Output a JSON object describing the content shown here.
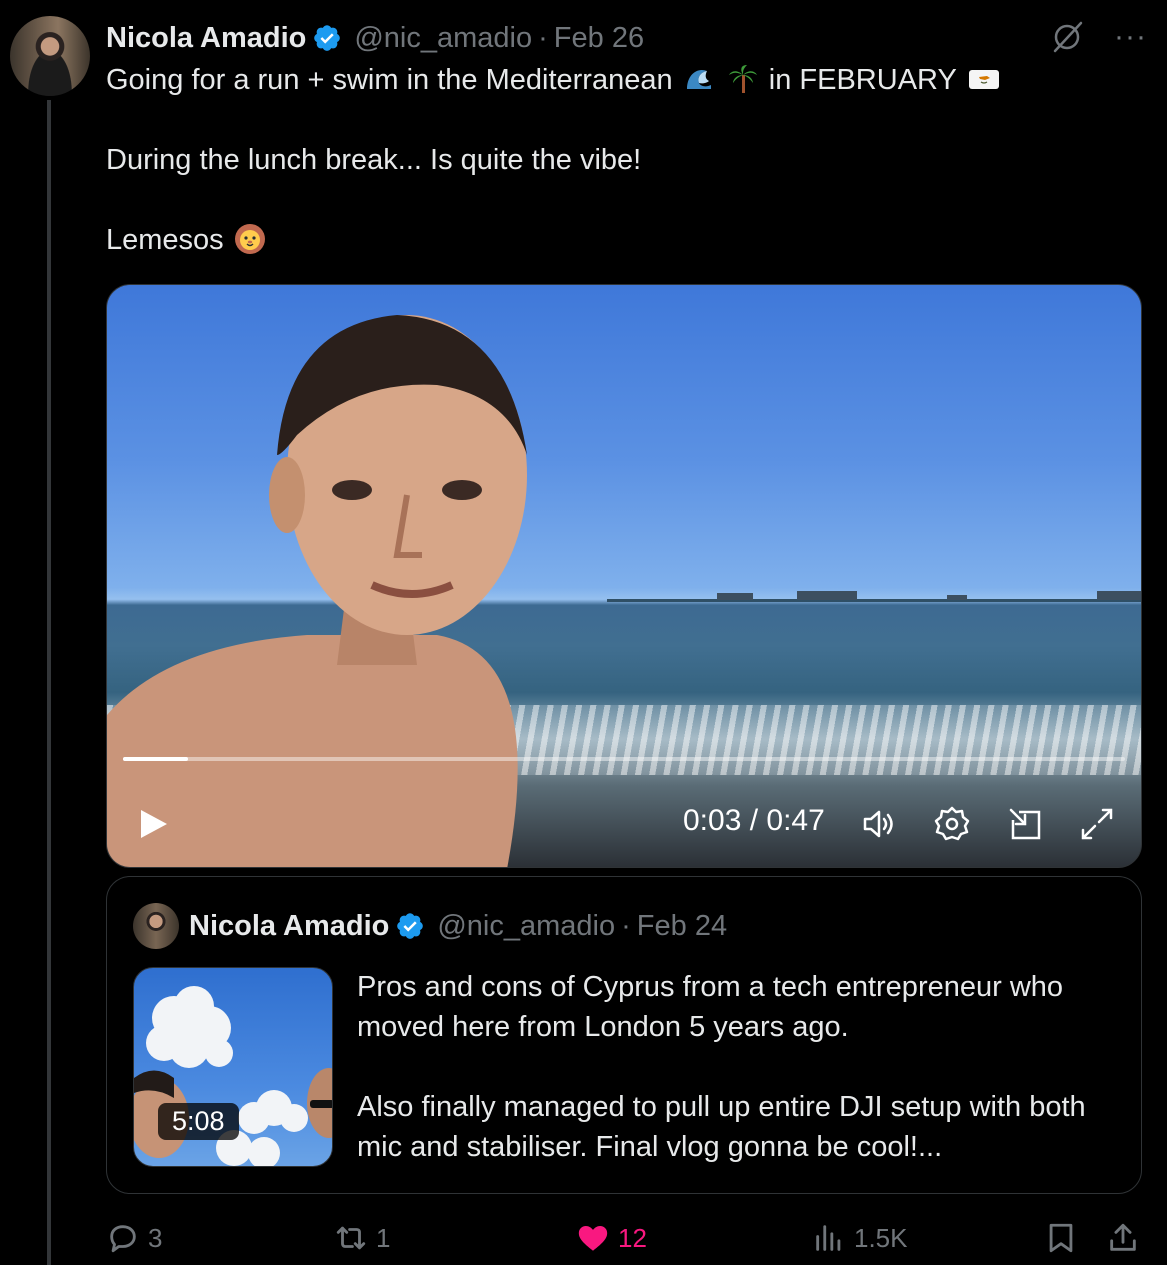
{
  "tweet": {
    "author_name": "Nicola Amadio",
    "handle": "@nic_amadio",
    "separator": "·",
    "date": "Feb 26",
    "more_label": "···",
    "text_line1_a": "Going for a run + swim in the Mediterranean",
    "text_line1_b": "in FEBRUARY",
    "text_line2": "During the lunch break... Is quite the vibe!",
    "text_line3": "Lemesos",
    "emojis": [
      "wave-icon",
      "palm-tree-icon",
      "cyprus-flag-icon",
      "lion-icon"
    ]
  },
  "video": {
    "current_time": "0:03",
    "duration": "0:47",
    "time_label": "0:03 / 0:47",
    "progress_fraction": 0.065,
    "controls": [
      "play-icon",
      "volume-icon",
      "settings-icon",
      "pip-icon",
      "fullscreen-icon"
    ]
  },
  "quote": {
    "author_name": "Nicola Amadio",
    "handle": "@nic_amadio",
    "separator": "·",
    "date": "Feb 24",
    "thumb_duration": "5:08",
    "text_p1": "Pros and cons of Cyprus from a tech entrepreneur who moved here from London 5 years ago.",
    "text_p2": "Also finally managed to pull up entire DJI setup with both mic and stabiliser. Final vlog gonna be cool!..."
  },
  "actions": {
    "replies": "3",
    "reposts": "1",
    "likes": "12",
    "views": "1.5K",
    "like_color": "#f91880",
    "muted_color": "#71767b"
  },
  "colors": {
    "background": "#000000",
    "text": "#e7e9ea",
    "secondary": "#71767b",
    "verified": "#1d9bf0",
    "border": "#2f3336"
  }
}
